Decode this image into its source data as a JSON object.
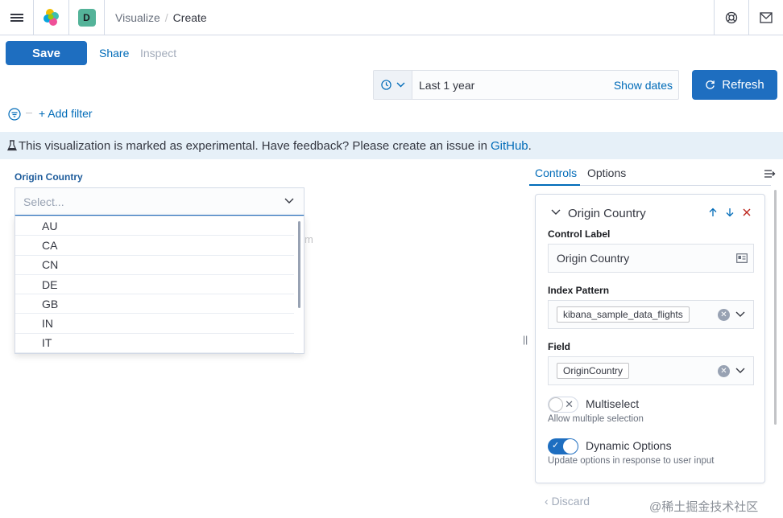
{
  "header": {
    "breadcrumbs": [
      "Visualize",
      "Create"
    ],
    "separator": "/",
    "space_initial": "D",
    "space_color": "#54b399"
  },
  "toolbar": {
    "save_label": "Save",
    "share_label": "Share",
    "inspect_label": "Inspect"
  },
  "timepicker": {
    "range": "Last 1 year",
    "show_dates": "Show dates",
    "refresh_label": "Refresh"
  },
  "filter": {
    "add_label": "+ Add filter"
  },
  "banner": {
    "text": "This visualization is marked as experimental. Have feedback? Please create an issue in",
    "link": "GitHub",
    "tail": "."
  },
  "preview": {
    "control_label": "Origin Country",
    "placeholder": "Select...",
    "options": [
      "AU",
      "CA",
      "CN",
      "DE",
      "GB",
      "IN",
      "IT"
    ],
    "ghost_char": "m"
  },
  "editor": {
    "tabs": [
      "Controls",
      "Options"
    ],
    "card_title": "Origin Country",
    "control_label_label": "Control Label",
    "control_label_value": "Origin Country",
    "index_pattern_label": "Index Pattern",
    "index_pattern_value": "kibana_sample_data_flights",
    "field_label": "Field",
    "field_value": "OriginCountry",
    "multiselect_label": "Multiselect",
    "multiselect_help": "Allow multiple selection",
    "multiselect_enabled": false,
    "dynamic_label": "Dynamic Options",
    "dynamic_help": "Update options in response to user input",
    "dynamic_enabled": true
  },
  "footer": {
    "discard_label": "Discard",
    "watermark": "@稀土掘金技术社区"
  },
  "colors": {
    "primary": "#1e6ec0",
    "link": "#006bb8",
    "banner_bg": "#e6f0f8",
    "danger": "#bd271e"
  }
}
